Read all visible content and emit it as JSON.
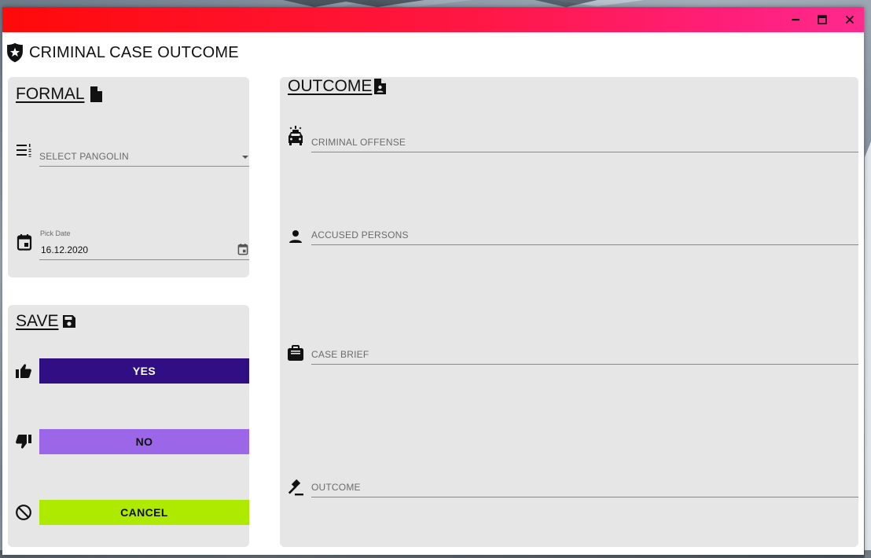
{
  "window": {
    "title": "CRIMINAL CASE OUTCOME",
    "controls": {
      "minimize": "minimize-icon",
      "maximize": "maximize-icon",
      "close": "close-icon"
    }
  },
  "formal": {
    "title": "FORMAL",
    "select_placeholder": "SELECT PANGOLIN",
    "date_label": "Pick Date",
    "date_value": "16.12.2020"
  },
  "save": {
    "title": "SAVE",
    "yes_label": "YES",
    "no_label": "NO",
    "cancel_label": "CANCEL"
  },
  "outcome": {
    "title": "OUTCOME",
    "fields": {
      "criminal_offense": "CRIMINAL OFFENSE",
      "accused_persons": "ACCUSED PERSONS",
      "case_brief": "CASE BRIEF",
      "outcome": "OUTCOME"
    }
  },
  "colors": {
    "titlebar_start": "#ff0a0a",
    "titlebar_end": "#ff2a8e",
    "yes_button": "#300f85",
    "no_button": "#9b66e8",
    "cancel_button": "#aeea00",
    "card_background": "#e6e6e6"
  }
}
